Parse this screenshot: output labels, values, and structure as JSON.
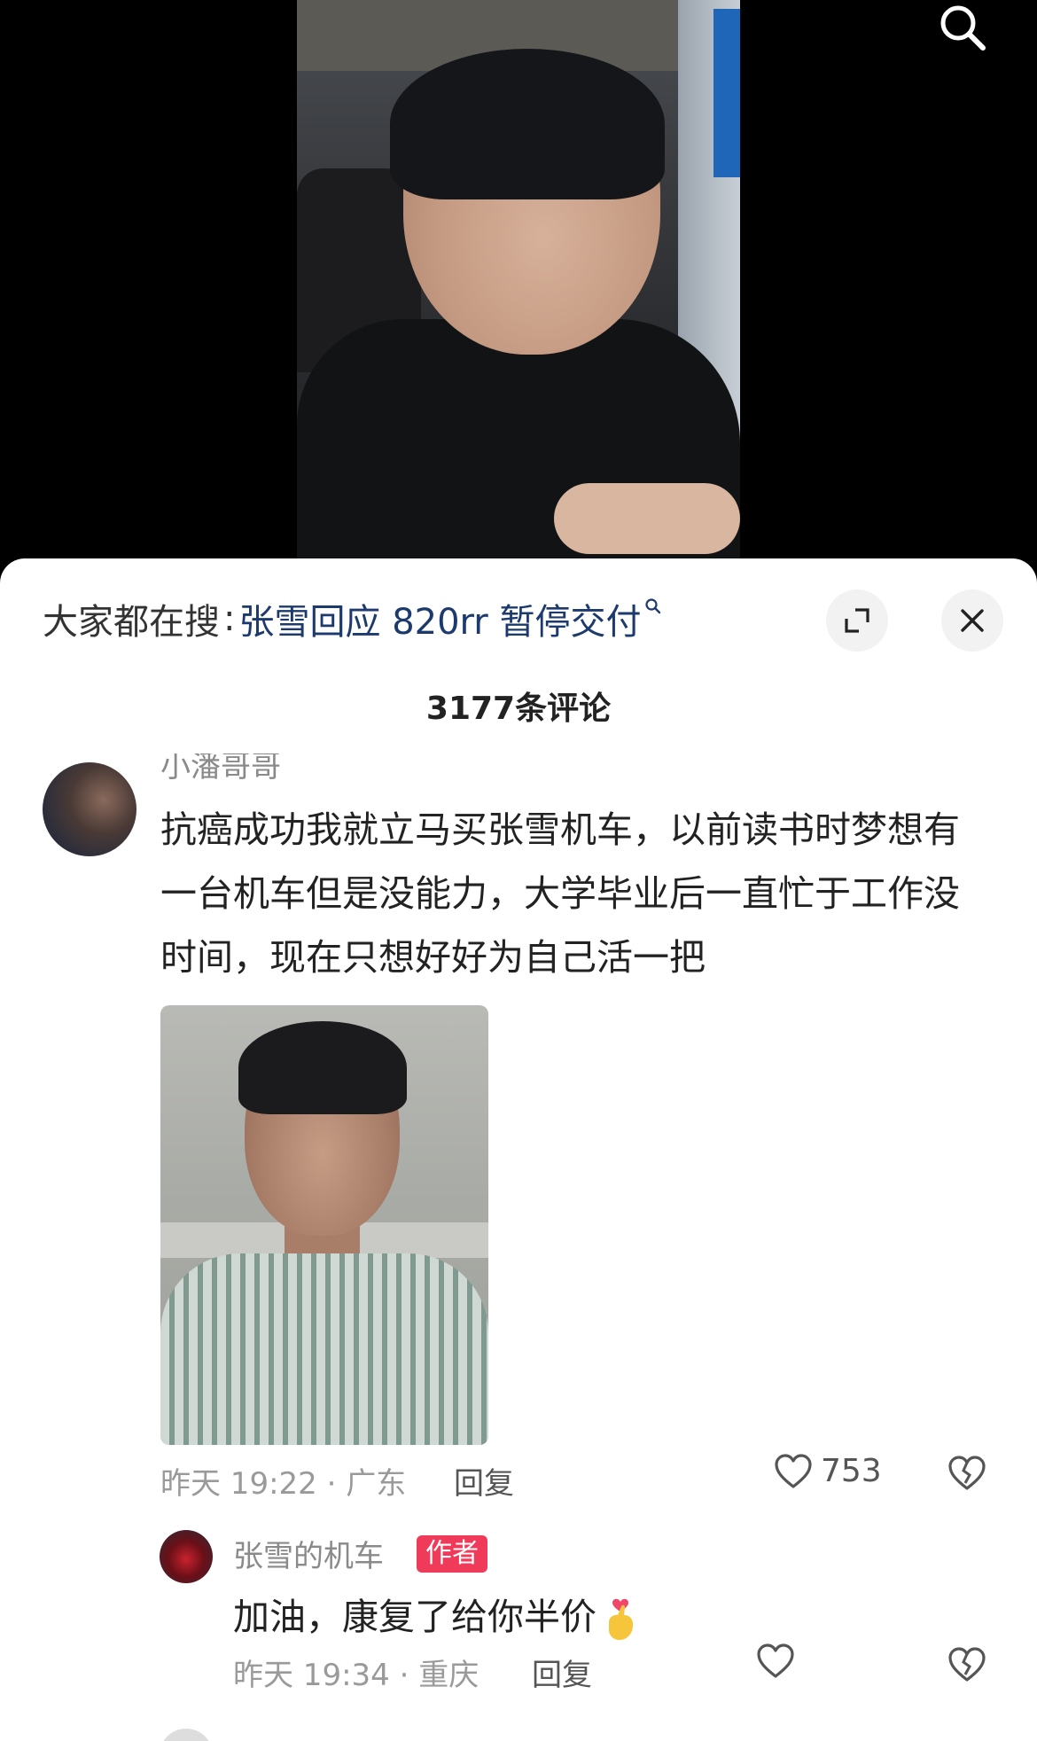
{
  "hot_search": {
    "prefix": "大家都在搜",
    "colon": ":",
    "query": "张雪回应 820rr 暂停交付"
  },
  "comments_header": {
    "count_label": "3177条评论"
  },
  "comments": [
    {
      "username": "小潘哥哥",
      "text": "抗癌成功我就立马买张雪机车，以前读书时梦想有一台机车但是没能力，大学毕业后一直忙于工作没时间，现在只想好好为自己活一把",
      "meta": "昨天 19:22 · 广东",
      "reply_label": "回复",
      "likes": "753"
    }
  ],
  "replies": [
    {
      "username": "张雪的机车",
      "badge": "作者",
      "text": "加油，康复了给你半价",
      "meta": "昨天 19:34 · 重庆",
      "reply_label": "回复"
    }
  ],
  "icons": {
    "search": "search-icon",
    "expand": "expand-icon",
    "close": "close-icon",
    "like": "heart-outline-icon",
    "dislike": "broken-heart-icon",
    "emoji": "finger-heart-emoji"
  },
  "colors": {
    "hot_query": "#1c3a6d",
    "author_badge": "#f03a5a"
  }
}
